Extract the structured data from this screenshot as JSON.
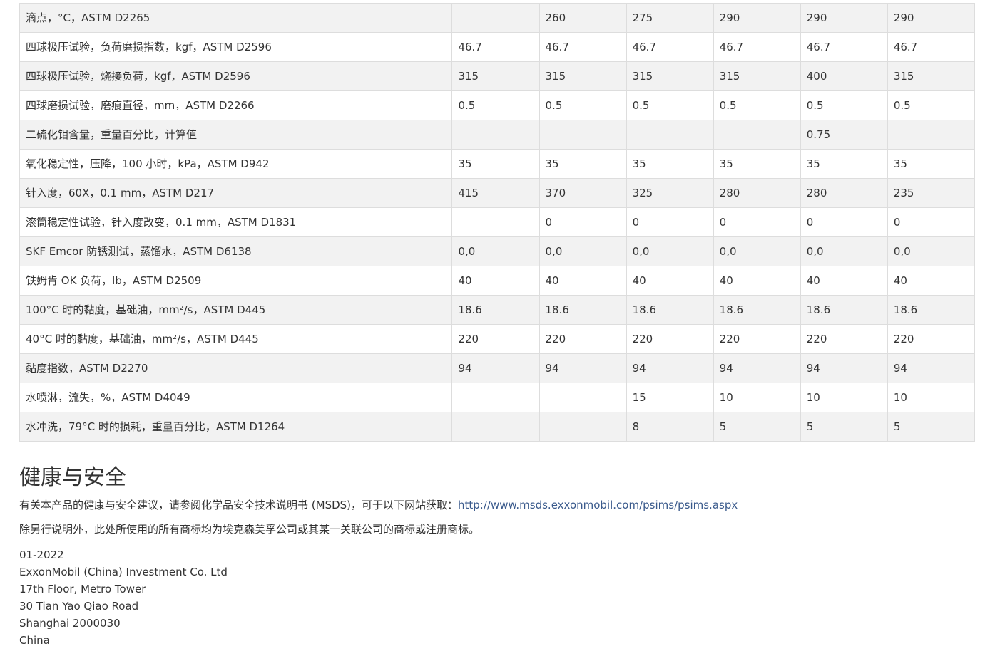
{
  "table": {
    "rows": [
      {
        "label": "滴点，°C，ASTM D2265",
        "values": [
          "",
          "260",
          "275",
          "290",
          "290",
          "290"
        ]
      },
      {
        "label": "四球极压试验，负荷磨损指数，kgf，ASTM D2596",
        "values": [
          "46.7",
          "46.7",
          "46.7",
          "46.7",
          "46.7",
          "46.7"
        ]
      },
      {
        "label": "四球极压试验，烧接负荷，kgf，ASTM D2596",
        "values": [
          "315",
          "315",
          "315",
          "315",
          "400",
          "315"
        ]
      },
      {
        "label": "四球磨损试验，磨痕直径，mm，ASTM D2266",
        "values": [
          "0.5",
          "0.5",
          "0.5",
          "0.5",
          "0.5",
          "0.5"
        ]
      },
      {
        "label": "二硫化钼含量，重量百分比，计算值",
        "values": [
          "",
          "",
          "",
          "",
          "0.75",
          ""
        ]
      },
      {
        "label": "氧化稳定性，压降，100 小时，kPa，ASTM D942",
        "values": [
          "35",
          "35",
          "35",
          "35",
          "35",
          "35"
        ]
      },
      {
        "label": "针入度，60X，0.1 mm，ASTM D217",
        "values": [
          "415",
          "370",
          "325",
          "280",
          "280",
          "235"
        ]
      },
      {
        "label": "滚筒稳定性试验，针入度改变，0.1 mm，ASTM D1831",
        "values": [
          "",
          "0",
          "0",
          "0",
          "0",
          "0"
        ]
      },
      {
        "label": "SKF Emcor 防锈测试，蒸馏水，ASTM D6138",
        "values": [
          "0,0",
          "0,0",
          "0,0",
          "0,0",
          "0,0",
          "0,0"
        ]
      },
      {
        "label": "铁姆肯 OK 负荷，lb，ASTM D2509",
        "values": [
          "40",
          "40",
          "40",
          "40",
          "40",
          "40"
        ]
      },
      {
        "label": "100°C 时的黏度，基础油，mm²/s，ASTM D445",
        "values": [
          "18.6",
          "18.6",
          "18.6",
          "18.6",
          "18.6",
          "18.6"
        ]
      },
      {
        "label": "40°C 时的黏度，基础油，mm²/s，ASTM D445",
        "values": [
          "220",
          "220",
          "220",
          "220",
          "220",
          "220"
        ]
      },
      {
        "label": "黏度指数，ASTM D2270",
        "values": [
          "94",
          "94",
          "94",
          "94",
          "94",
          "94"
        ]
      },
      {
        "label": "水喷淋，流失，%，ASTM D4049",
        "values": [
          "",
          "",
          "15",
          "10",
          "10",
          "10"
        ]
      },
      {
        "label": "水冲洗，79°C 时的损耗，重量百分比，ASTM D1264",
        "values": [
          "",
          "",
          "8",
          "5",
          "5",
          "5"
        ]
      }
    ]
  },
  "health_safety": {
    "title": "健康与安全",
    "msds_text": "有关本产品的健康与安全建议，请参阅化学品安全技术说明书 (MSDS)，可于以下网站获取：",
    "msds_link": "http://www.msds.exxonmobil.com/psims/psims.aspx",
    "trademark_text": "除另行说明外，此处所使用的所有商标均为埃克森美孚公司或其某一关联公司的商标或注册商标。"
  },
  "address": {
    "lines": [
      "01-2022",
      "ExxonMobil (China) Investment Co. Ltd",
      "17th Floor, Metro Tower",
      "30 Tian Yao Qiao Road",
      "Shanghai 2000030",
      "China"
    ]
  }
}
